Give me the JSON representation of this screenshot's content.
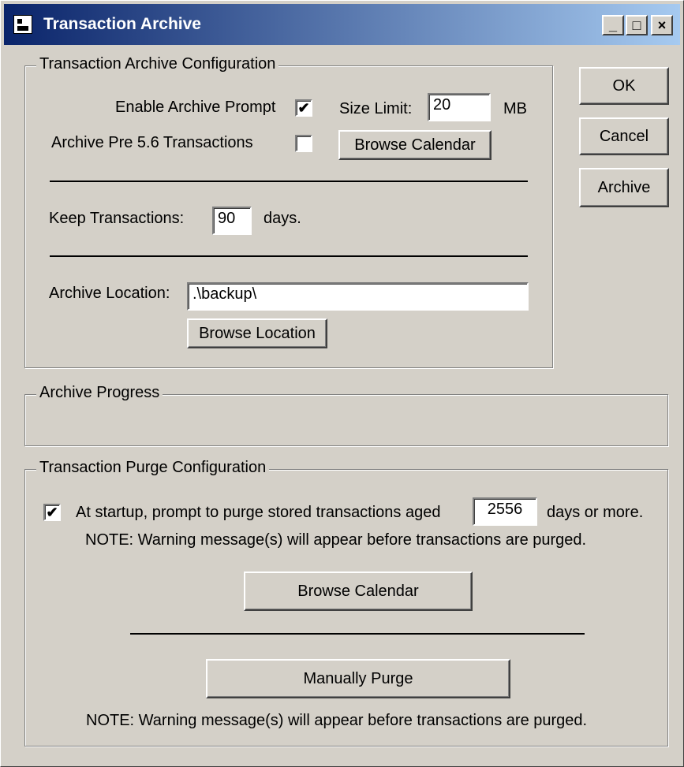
{
  "window": {
    "title": "Transaction Archive",
    "controls": {
      "minimize": "_",
      "maximize": "□",
      "close": "×"
    }
  },
  "side_buttons": {
    "ok": "OK",
    "cancel": "Cancel",
    "archive": "Archive"
  },
  "archive_config": {
    "legend": "Transaction Archive Configuration",
    "enable_prompt_label": "Enable Archive Prompt",
    "enable_prompt_checked": "✔",
    "size_limit_label": "Size Limit:",
    "size_limit_value": "20",
    "size_limit_unit": "MB",
    "pre56_label": "Archive Pre 5.6 Transactions",
    "pre56_checked": "",
    "browse_calendar": "Browse Calendar",
    "keep_label": "Keep Transactions:",
    "keep_value": "90",
    "keep_unit": "days.",
    "location_label": "Archive Location:",
    "location_value": ".\\backup\\",
    "browse_location": "Browse Location"
  },
  "archive_progress": {
    "legend": "Archive Progress"
  },
  "purge_config": {
    "legend": "Transaction Purge Configuration",
    "prompt_checked": "✔",
    "prompt_text": "At startup, prompt to purge stored transactions aged",
    "days_value": "2556",
    "days_suffix": "days or more.",
    "note_top": "NOTE:  Warning message(s) will appear before transactions are purged.",
    "browse_calendar": "Browse Calendar",
    "manually_purge": "Manually Purge",
    "note_bottom": "NOTE:  Warning message(s) will appear before transactions are purged."
  }
}
